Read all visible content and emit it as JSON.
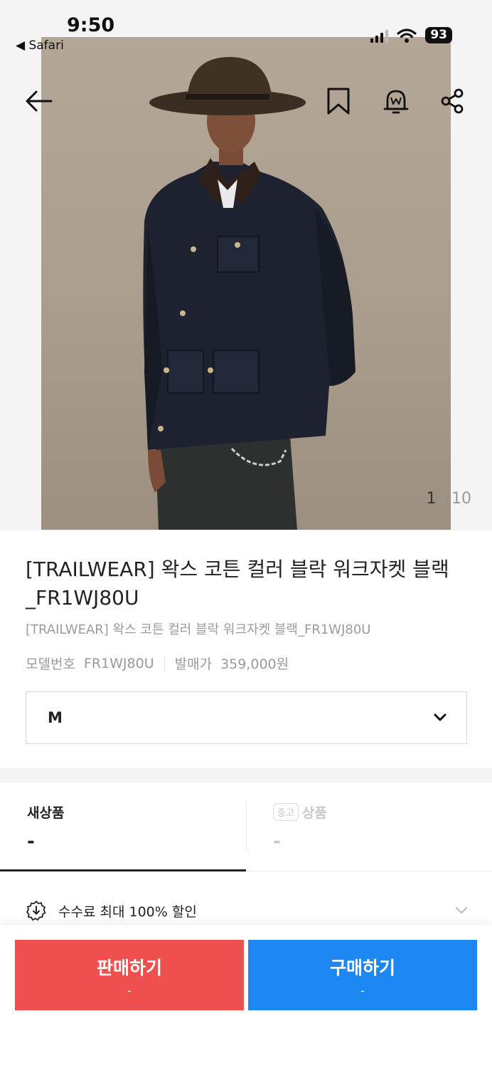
{
  "status_bar": {
    "time": "9:50",
    "back_label": "◀ Safari",
    "battery": "93",
    "icons": [
      "signal-icon",
      "wifi-icon",
      "battery-icon"
    ]
  },
  "gallery": {
    "current": "1",
    "separator": "/",
    "total": "10"
  },
  "nav_icons": [
    "back-arrow-icon",
    "bookmark-icon",
    "alert-bell-icon",
    "share-icon"
  ],
  "product": {
    "title": "[TRAILWEAR] 왁스 코튼 컬러 블락 워크자켓 블랙_FR1WJ80U",
    "subtitle": "[TRAILWEAR] 왁스 코튼 컬러 블락 워크자켓 블랙_FR1WJ80U",
    "model_label": "모델번호",
    "model_value": "FR1WJ80U",
    "release_label": "발매가",
    "release_value": "359,000원"
  },
  "size_select": {
    "value": "M"
  },
  "tabs": {
    "new": {
      "label": "새상품",
      "price": "-"
    },
    "used": {
      "badge": "중고",
      "label": "상품",
      "price": "-"
    }
  },
  "fee": {
    "label": "수수료 최대 100% 할인"
  },
  "actions": {
    "sell_label": "판매하기",
    "sell_sub": "-",
    "buy_label": "구매하기",
    "buy_sub": "-"
  },
  "colors": {
    "sell": "#ef4f4d",
    "buy": "#1e88f2",
    "text": "#222222",
    "muted": "#999999"
  }
}
